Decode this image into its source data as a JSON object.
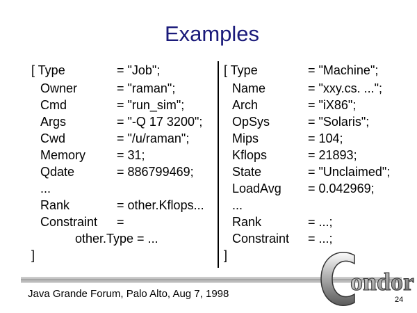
{
  "title": "Examples",
  "job_ad": [
    {
      "attr": "[ Type",
      "value": "= \"Job\";"
    },
    {
      "attr": "Owner",
      "value": "= \"raman\";"
    },
    {
      "attr": "Cmd",
      "value": "= \"run_sim\";"
    },
    {
      "attr": "Args",
      "value": "= \"-Q 17 3200\";"
    },
    {
      "attr": "Cwd",
      "value": "= \"/u/raman\";"
    },
    {
      "attr": "Memory",
      "value": "= 31;"
    },
    {
      "attr": "Qdate",
      "value": "= 886799469;"
    },
    {
      "attr": "...",
      "value": ""
    },
    {
      "attr": "Rank",
      "value": "= other.Kflops..."
    },
    {
      "attr": "Constraint",
      "value": "="
    },
    {
      "attr": "",
      "value": "other.Type = ..."
    },
    {
      "attr": "]",
      "value": ""
    }
  ],
  "machine_ad": [
    {
      "attr": "[ Type",
      "value": "= \"Machine\";"
    },
    {
      "attr": "Name",
      "value": "= \"xxy.cs. ...\";"
    },
    {
      "attr": "Arch",
      "value": "= \"iX86\";"
    },
    {
      "attr": "OpSys",
      "value": "= \"Solaris\";"
    },
    {
      "attr": "Mips",
      "value": "= 104;"
    },
    {
      "attr": "Kflops",
      "value": "= 21893;"
    },
    {
      "attr": "State",
      "value": "= \"Unclaimed\";"
    },
    {
      "attr": "LoadAvg",
      "value": "= 0.042969;"
    },
    {
      "attr": "...",
      "value": ""
    },
    {
      "attr": "Rank",
      "value": "= ...;"
    },
    {
      "attr": "Constraint",
      "value": "= ...;"
    },
    {
      "attr": "]",
      "value": ""
    }
  ],
  "footer": {
    "text": "Java Grande Forum, Palo Alto, Aug 7, 1998",
    "page_number": "24"
  },
  "logo": {
    "text": "Condor"
  }
}
